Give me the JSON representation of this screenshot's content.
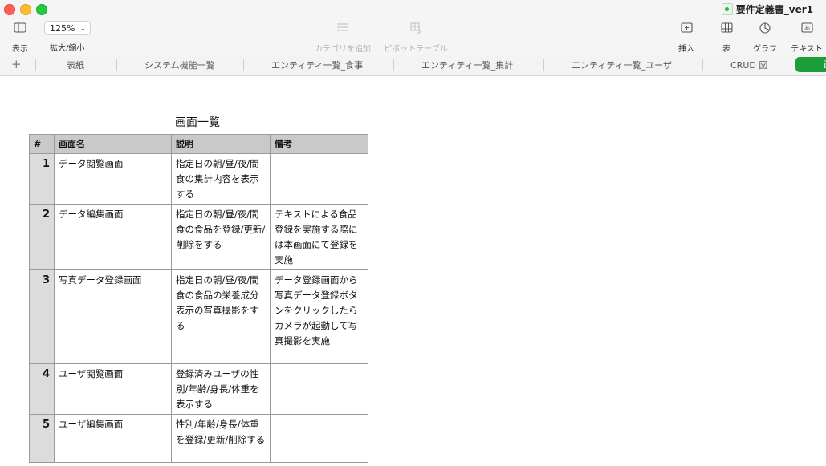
{
  "window": {
    "title": "要件定義書_ver1"
  },
  "toolbar": {
    "view_label": "表示",
    "zoom_value": "125%",
    "zoom_label": "拡大/縮小",
    "add_category_label": "カテゴリを追加",
    "pivot_table_label": "ピボットテーブル",
    "insert_label": "挿入",
    "table_label": "表",
    "chart_label": "グラフ",
    "text_label": "テキスト",
    "icons": {
      "view": "sidebar-icon",
      "add_category": "list-icon",
      "pivot_table": "pivot-table-icon",
      "insert": "insert-icon",
      "table": "table-icon",
      "chart": "pie-chart-icon",
      "text": "text-box-icon"
    }
  },
  "tabs": {
    "add": "+",
    "items": [
      {
        "label": "表紙"
      },
      {
        "label": "システム機能一覧"
      },
      {
        "label": "エンティティ一覧_食事"
      },
      {
        "label": "エンティティ一覧_集計"
      },
      {
        "label": "エンティティ一覧_ユーザ"
      },
      {
        "label": "CRUD 図"
      },
      {
        "label": "画"
      }
    ],
    "active_color": "#1b9e3a"
  },
  "sheet": {
    "title": "画面一覧",
    "headers": [
      "#",
      "画面名",
      "説明",
      "備考"
    ],
    "rows": [
      {
        "idx": "1",
        "name": "データ閲覧画面",
        "desc": "指定日の朝/昼/夜/間食の集計内容を表示する",
        "note": ""
      },
      {
        "idx": "2",
        "name": "データ編集画面",
        "desc": "指定日の朝/昼/夜/間食の食品を登録/更新/削除をする",
        "note": "テキストによる食品登録を実施する際には本画面にて登録を実施"
      },
      {
        "idx": "3",
        "name": "写真データ登録画面",
        "desc": "指定日の朝/昼/夜/間食の食品の栄養成分表示の写真撮影をする",
        "note": "データ登録画面から写真データ登録ボタンをクリックしたらカメラが起動して写真撮影を実施"
      },
      {
        "idx": "4",
        "name": "ユーザ閲覧画面",
        "desc": "登録済みユーザの性別/年齢/身長/体重を表示する",
        "note": ""
      },
      {
        "idx": "5",
        "name": "ユーザ編集画面",
        "desc": "性別/年齢/身長/体重を登録/更新/削除する",
        "note": ""
      }
    ]
  }
}
